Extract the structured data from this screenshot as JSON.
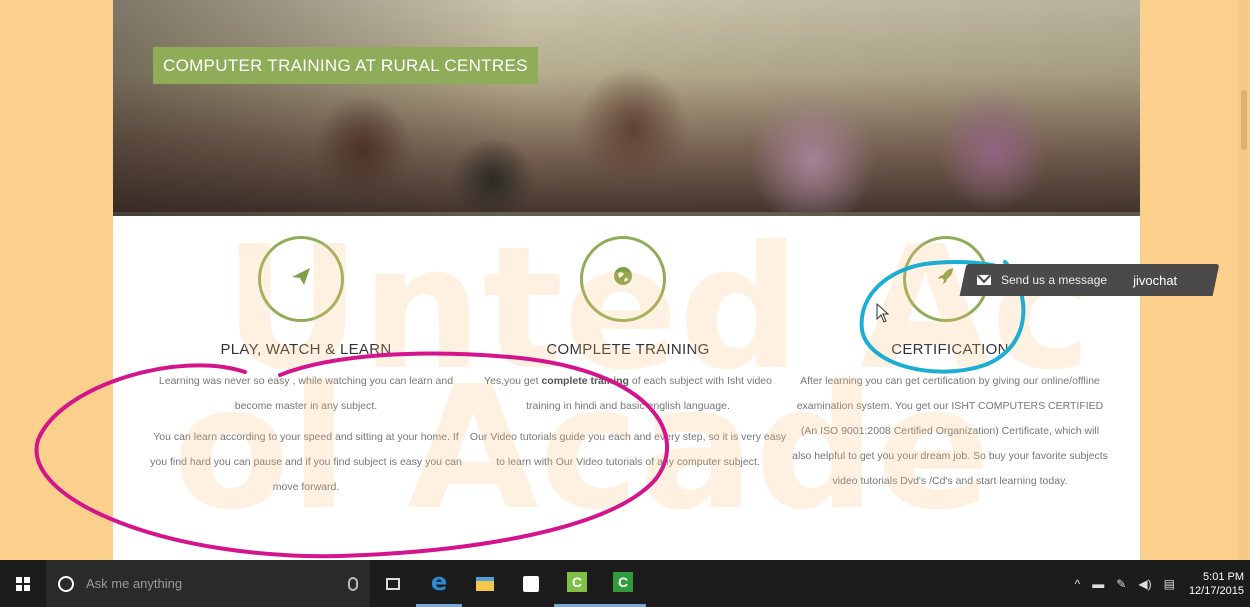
{
  "hero": {
    "caption": "COMPUTER TRAINING AT RURAL CENTRES"
  },
  "watermark": {
    "line1": "Unted Ac",
    "line2": "ol Acade"
  },
  "features": [
    {
      "icon": "paper-plane-icon",
      "title": "PLAY, WATCH & LEARN",
      "paragraphs": [
        "Learning was never so easy , while watching you can learn and become master in any subject.",
        "You can learn according to your speed and sitting at your home. If you find hard you can pause and if you find subject is easy you can move forward."
      ]
    },
    {
      "icon": "globe-icon",
      "title": "COMPLETE TRAINING",
      "paragraphs_html_parts": {
        "p1_a": "Yes,you get ",
        "p1_b": "complete training",
        "p1_c": " of each subject with Isht video training in hindi and basic english language.",
        "p2": "Our Video tutorials guide you each and every step, so it is very easy to learn with Our Video tutorials of any computer subject."
      }
    },
    {
      "icon": "rocket-icon",
      "title": "CERTIFICATION",
      "paragraphs": [
        "After learning you can get certification by giving our online/offline examination system. You get our ISHT COMPUTERS CERTIFIED (An ISO 9001:2008 Certified Organization) Certificate, which will also helpful to get you your dream job. So buy your favorite subjects video tutorials Dvd's /Cd's and start learning today."
      ]
    }
  ],
  "chat_widget": {
    "label": "Send us a message",
    "brand": "jivochat"
  },
  "annotations": {
    "pink_color": "#d4148c",
    "blue_color": "#1aaed3"
  },
  "taskbar": {
    "search_placeholder": "Ask me anything",
    "time": "5:01 PM",
    "date": "12/17/2015",
    "tray_icons": [
      "chevron-up-icon",
      "network-icon",
      "pen-icon",
      "volume-icon",
      "notification-icon"
    ]
  }
}
